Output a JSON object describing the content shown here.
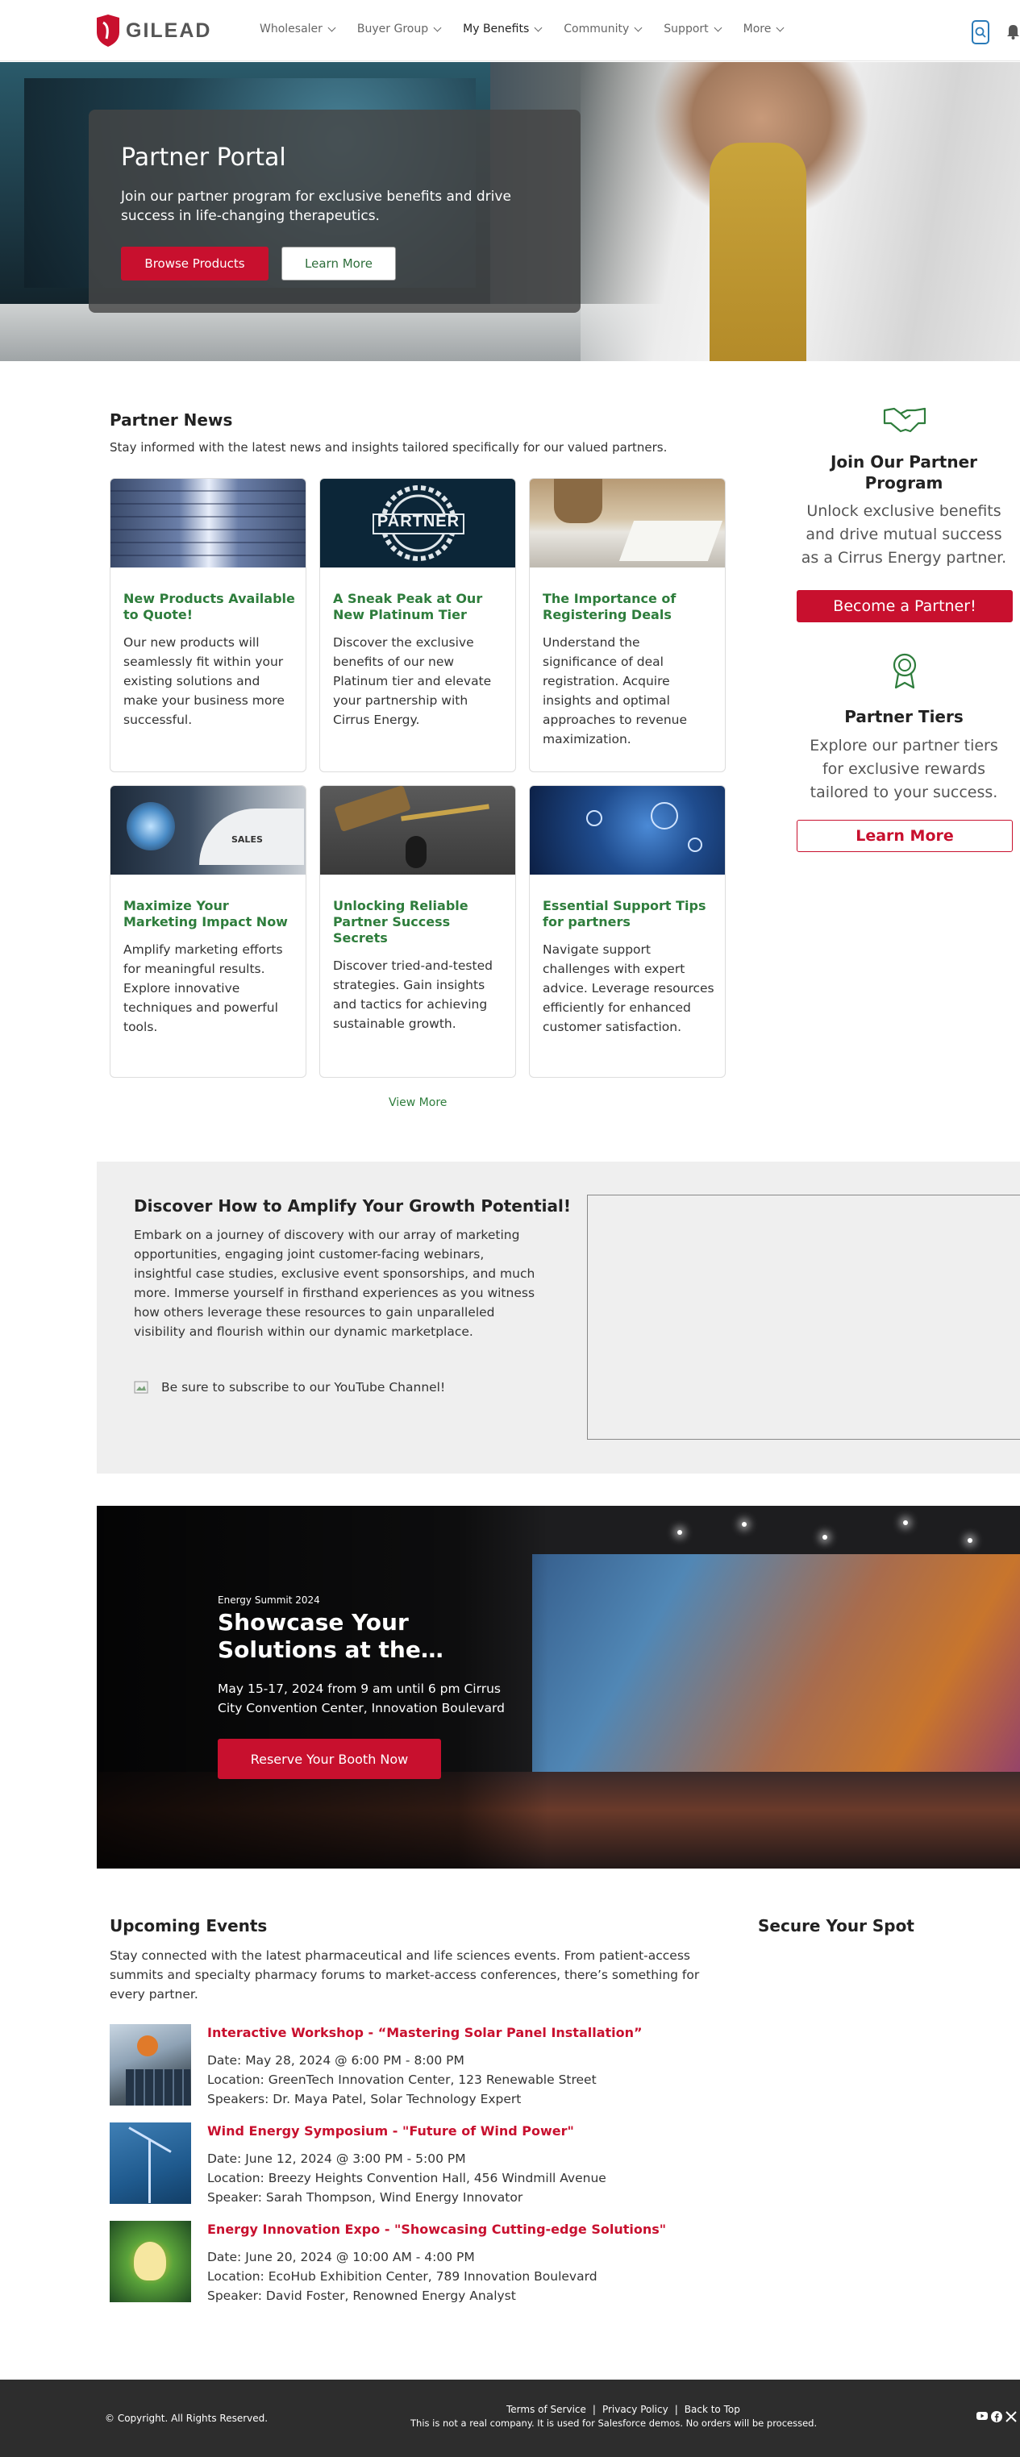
{
  "brand": {
    "name": "GILEAD"
  },
  "nav": {
    "items": [
      {
        "label": "Wholesaler"
      },
      {
        "label": "Buyer Group"
      },
      {
        "label": "My Benefits"
      },
      {
        "label": "Community"
      },
      {
        "label": "Support"
      },
      {
        "label": "More"
      }
    ],
    "active": "My Benefits"
  },
  "hero": {
    "title": "Partner Portal",
    "subtitle": "Join our partner program for exclusive benefits and drive success in life-changing therapeutics.",
    "primary_button": "Browse Products",
    "secondary_button": "Learn More"
  },
  "news": {
    "title": "Partner News",
    "subtitle": "Stay informed with the latest news and insights tailored specifically for our valued partners.",
    "cards": [
      {
        "title": "New Products Available to Quote!",
        "text": "Our new products will seamlessly fit within your existing solutions and make your business more successful."
      },
      {
        "title": "A Sneak Peak at Our New Platinum Tier",
        "text": "Discover the exclusive benefits of our new Platinum tier and elevate your partnership with Cirrus Energy.",
        "image_text": "PARTNER"
      },
      {
        "title": "The Importance of Registering Deals",
        "text": "Understand the significance of deal registration. Acquire insights and optimal approaches to revenue maximization."
      },
      {
        "title": "Maximize Your Marketing Impact Now",
        "text": "Amplify marketing efforts for meaningful results. Explore innovative techniques and powerful tools.",
        "image_text": "SALES"
      },
      {
        "title": "Unlocking Reliable Partner Success Secrets",
        "text": "Discover tried-and-tested strategies. Gain insights and tactics for achieving sustainable growth."
      },
      {
        "title": "Essential Support Tips for partners",
        "text": "Navigate support challenges with expert advice. Leverage resources efficiently for enhanced customer satisfaction."
      }
    ],
    "view_more": "View More"
  },
  "sidebar": {
    "join": {
      "title": "Join Our Partner Program",
      "text": "Unlock exclusive benefits and drive mutual success as a Cirrus Energy partner.",
      "button": "Become a Partner!"
    },
    "tiers": {
      "title": "Partner Tiers",
      "text": "Explore our partner tiers for exclusive rewards tailored to your success.",
      "button": "Learn More"
    }
  },
  "discover": {
    "title": "Discover How to Amplify Your Growth Potential!",
    "text": "Embark on a journey of discovery with our array of marketing opportunities, engaging joint customer-facing webinars, insightful case studies, exclusive event sponsorships, and much more. Immerse yourself in firsthand experiences as you witness how others leverage these resources to gain unparalleled visibility and flourish within our dynamic marketplace.",
    "youtube_text": "Be sure to subscribe to our YouTube Channel!"
  },
  "summit": {
    "eyebrow": "Energy Summit 2024",
    "title": "Showcase Your Solutions at the…",
    "text": "May 15-17, 2024 from 9 am until 6 pm Cirrus City Convention Center, Innovation Boulevard",
    "button": "Reserve Your Booth Now"
  },
  "events": {
    "title": "Upcoming Events",
    "subtitle": "Stay connected with the latest pharmaceutical and life sciences events. From patient-access summits and specialty pharmacy forums to market-access conferences, there’s something for every partner.",
    "side_title": "Secure Your Spot",
    "items": [
      {
        "name": "Interactive Workshop - “Mastering Solar Panel Installation”",
        "date": "Date: May 28, 2024 @ 6:00 PM - 8:00 PM",
        "location": "Location: GreenTech Innovation Center, 123 Renewable Street",
        "speaker": "Speakers: Dr. Maya Patel, Solar Technology Expert"
      },
      {
        "name": "Wind Energy Symposium - \"Future of Wind Power\"",
        "date": "Date: June 12, 2024 @ 3:00 PM - 5:00 PM",
        "location": "Location: Breezy Heights Convention Hall, 456 Windmill Avenue",
        "speaker": "Speaker: Sarah Thompson, Wind Energy Innovator"
      },
      {
        "name": "Energy Innovation Expo - \"Showcasing Cutting-edge Solutions\"",
        "date": "Date: June 20, 2024 @ 10:00 AM - 4:00 PM",
        "location": "Location: EcoHub Exhibition Center, 789 Innovation Boulevard",
        "speaker": "Speaker: David Foster, Renowned Energy Analyst"
      }
    ]
  },
  "footer": {
    "copyright": "© Copyright. All Rights Reserved.",
    "links": [
      "Terms of Service",
      "Privacy Policy",
      "Back to Top"
    ],
    "note": "This is not a real company. It is used for Salesforce demos. No orders will be processed."
  },
  "colors": {
    "accent_red": "#c8102e",
    "accent_green": "#2e7d3c",
    "footer_bg": "#2d2d2d"
  }
}
